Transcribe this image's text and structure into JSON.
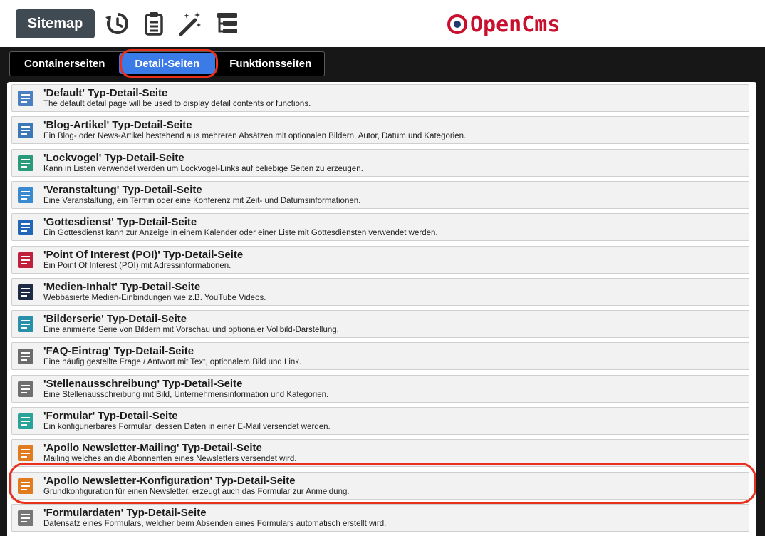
{
  "toolbar": {
    "sitemap_label": "Sitemap",
    "icons": [
      "history-icon",
      "clipboard-icon",
      "magic-wand-icon",
      "tree-list-icon"
    ]
  },
  "logo": {
    "text": "OpenCms"
  },
  "tabs": [
    {
      "label": "Containerseiten",
      "active": false
    },
    {
      "label": "Detail-Seiten",
      "active": true
    },
    {
      "label": "Funktionsseiten",
      "active": false
    }
  ],
  "items": [
    {
      "title": "'Default' Typ-Detail-Seite",
      "desc": "The default detail page will be used to display detail contents or functions.",
      "icon": "default-page-icon",
      "color": "#4a7fc1"
    },
    {
      "title": "'Blog-Artikel' Typ-Detail-Seite",
      "desc": "Ein Blog- oder News-Artikel bestehend aus mehreren Absätzen mit optionalen Bildern, Autor, Datum und Kategorien.",
      "icon": "blog-article-icon",
      "color": "#3a78b8"
    },
    {
      "title": "'Lockvogel' Typ-Detail-Seite",
      "desc": "Kann in Listen verwendet werden um Lockvogel-Links auf beliebige Seiten zu erzeugen.",
      "icon": "list-icon",
      "color": "#2b9a7a"
    },
    {
      "title": "'Veranstaltung' Typ-Detail-Seite",
      "desc": "Eine Veranstaltung, ein Termin oder eine Konferenz mit Zeit- und Datumsinformationen.",
      "icon": "calendar-icon",
      "color": "#3a8ad0"
    },
    {
      "title": "'Gottesdienst' Typ-Detail-Seite",
      "desc": "Ein Gottesdienst kann zur Anzeige in einem Kalender oder einer Liste mit Gottesdiensten verwendet werden.",
      "icon": "church-icon",
      "color": "#2266b8"
    },
    {
      "title": "'Point Of Interest (POI)' Typ-Detail-Seite",
      "desc": "Ein Point Of Interest (POI) mit Adressinformationen.",
      "icon": "map-pin-icon",
      "color": "#c0203a"
    },
    {
      "title": "'Medien-Inhalt' Typ-Detail-Seite",
      "desc": "Webbasierte Medien-Einbindungen wie z.B. YouTube Videos.",
      "icon": "clapperboard-icon",
      "color": "#1f2a44"
    },
    {
      "title": "'Bilderserie' Typ-Detail-Seite",
      "desc": "Eine animierte Serie von Bildern mit Vorschau und optionaler Vollbild-Darstellung.",
      "icon": "image-gallery-icon",
      "color": "#2a8fa8"
    },
    {
      "title": "'FAQ-Eintrag' Typ-Detail-Seite",
      "desc": "Eine häufig gestellte Frage / Antwort mit Text, optionalem Bild und Link.",
      "icon": "question-icon",
      "color": "#6b6b6b"
    },
    {
      "title": "'Stellenausschreibung' Typ-Detail-Seite",
      "desc": "Eine Stellenausschreibung mit Bild, Unternehmensinformation und Kategorien.",
      "icon": "briefcase-icon",
      "color": "#6f6f6f"
    },
    {
      "title": "'Formular' Typ-Detail-Seite",
      "desc": "Ein konfigurierbares Formular, dessen Daten in einer E-Mail versendet werden.",
      "icon": "envelope-icon",
      "color": "#2aa39a"
    },
    {
      "title": "'Apollo Newsletter-Mailing' Typ-Detail-Seite",
      "desc": "Mailing welches an die Abonnenten eines Newsletters versendet wird.",
      "icon": "newsletter-icon",
      "color": "#e07b20"
    },
    {
      "title": "'Apollo Newsletter-Konfiguration' Typ-Detail-Seite",
      "desc": "Grundkonfiguration für einen Newsletter, erzeugt auch das Formular zur Anmeldung.",
      "icon": "newsletter-config-icon",
      "color": "#e07b20"
    },
    {
      "title": "'Formulardaten' Typ-Detail-Seite",
      "desc": "Datensatz eines Formulars, welcher beim Absenden eines Formulars automatisch erstellt wird.",
      "icon": "form-data-icon",
      "color": "#777777"
    }
  ]
}
